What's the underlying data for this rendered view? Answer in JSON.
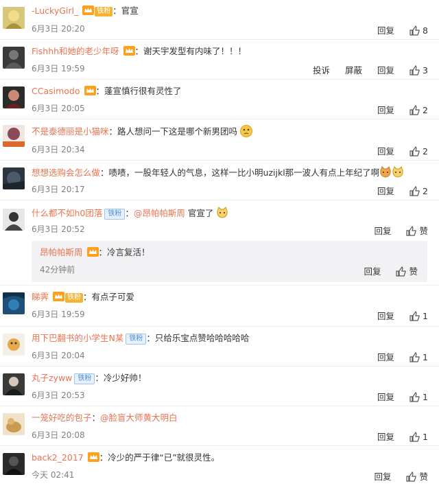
{
  "labels": {
    "reply": "回复",
    "report": "投诉",
    "block": "屏蔽",
    "like": "赞"
  },
  "colors": {
    "username": "#eb7350",
    "date": "#808080",
    "fan_badge": "#4b8dd6"
  },
  "comments": [
    {
      "user": "-LuckyGirl_",
      "text": "官宣",
      "date": "6月3日 20:20",
      "likes": "8",
      "badge": "vip-tiefen",
      "badge_text": "铁粉"
    },
    {
      "user": "Fishhh和她的老少年呀",
      "text": "谢天宇发型有内味了！！！",
      "date": "6月3日 19:59",
      "likes": "3",
      "badge": "vip"
    },
    {
      "user": "CCasimodo",
      "text": "蓬宣慎行很有灵性了",
      "date": "6月3日 20:05",
      "likes": "2",
      "badge": "vip"
    },
    {
      "user": "不是泰德丽是小猫咪",
      "text": "路人想问一下这是哪个新男团吗",
      "date": "6月3日 20:34",
      "likes": "2",
      "badge": "none",
      "emoji": "puzzled-emoji"
    },
    {
      "user": "想想选购会怎么做",
      "text": "啧啧，一股年轻人的气息，这样一比小明uzijkl那一波人有点上年纪了啊",
      "date": "6月3日 20:17",
      "likes": "2",
      "badge": "none",
      "emoji": "cat-emoji"
    },
    {
      "user": "什么都不如h0团落",
      "text": "@昂帕帕斯周 官宣了",
      "mention": "@昂帕帕斯周",
      "plain": " 官宣了",
      "date": "6月3日 20:52",
      "likes": "赞",
      "badge": "fan",
      "badge_text": "铁粉"
    },
    {
      "user": "昂帕帕斯周",
      "text": "冷言复活！",
      "date": "42分钟前",
      "likes": "赞",
      "badge": "vip",
      "nested": true
    },
    {
      "user": "睇霁",
      "text": "有点子可爱",
      "date": "6月3日 19:59",
      "likes": "1",
      "badge": "vip-tiefen",
      "badge_text": "铁粉"
    },
    {
      "user": "用下巴翻书的小学生N某",
      "text": "只给乐宝点赞哈哈哈哈哈",
      "date": "6月3日 20:04",
      "likes": "1",
      "badge": "fan",
      "badge_text": "铁粉"
    },
    {
      "user": "丸子zyww",
      "text": "冷少好帅！",
      "date": "6月3日 20:53",
      "likes": "1",
      "badge": "fan",
      "badge_text": "铁粉"
    },
    {
      "user": "一笼好吃的包子",
      "text": "@脸盲大师黄大明白",
      "mention": "@脸盲大师黄大明白",
      "date": "6月3日 20:08",
      "likes": "1",
      "badge": "none"
    },
    {
      "user": "back2_2017",
      "text": "冷少的严于律“已”就很灵性。",
      "date": "今天 02:41",
      "likes": "赞",
      "badge": "vip"
    }
  ]
}
